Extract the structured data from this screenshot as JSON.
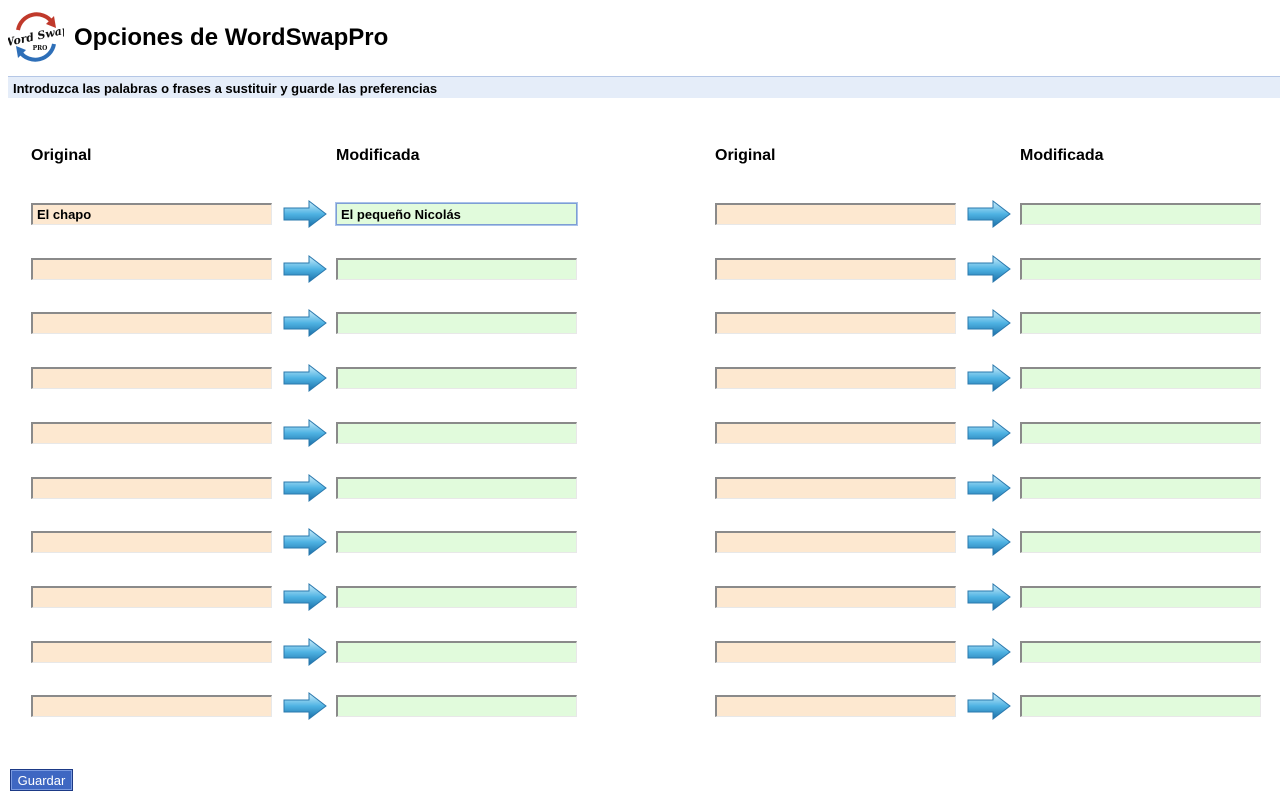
{
  "header": {
    "logo_text": "Word Swap",
    "logo_badge": "PRO",
    "title": "Opciones de WordSwapPro"
  },
  "instructions": "Introduzca las palabras o frases a sustituir y guarde las preferencias",
  "columns": {
    "original_label": "Original",
    "modified_label": "Modificada"
  },
  "arrow_icon": "right-arrow-icon",
  "colors": {
    "original_field_bg": "#fde8d0",
    "modified_field_bg": "#e1fbdc",
    "save_button_bg": "#3e67c2",
    "instruction_bar_bg": "#e5edf9"
  },
  "pairs_left": [
    {
      "original": "El chapo",
      "modified": "El pequeño Nicolás"
    },
    {
      "original": "",
      "modified": ""
    },
    {
      "original": "",
      "modified": ""
    },
    {
      "original": "",
      "modified": ""
    },
    {
      "original": "",
      "modified": ""
    },
    {
      "original": "",
      "modified": ""
    },
    {
      "original": "",
      "modified": ""
    },
    {
      "original": "",
      "modified": ""
    },
    {
      "original": "",
      "modified": ""
    },
    {
      "original": "",
      "modified": ""
    }
  ],
  "pairs_right": [
    {
      "original": "",
      "modified": ""
    },
    {
      "original": "",
      "modified": ""
    },
    {
      "original": "",
      "modified": ""
    },
    {
      "original": "",
      "modified": ""
    },
    {
      "original": "",
      "modified": ""
    },
    {
      "original": "",
      "modified": ""
    },
    {
      "original": "",
      "modified": ""
    },
    {
      "original": "",
      "modified": ""
    },
    {
      "original": "",
      "modified": ""
    },
    {
      "original": "",
      "modified": ""
    }
  ],
  "save_button_label": "Guardar"
}
